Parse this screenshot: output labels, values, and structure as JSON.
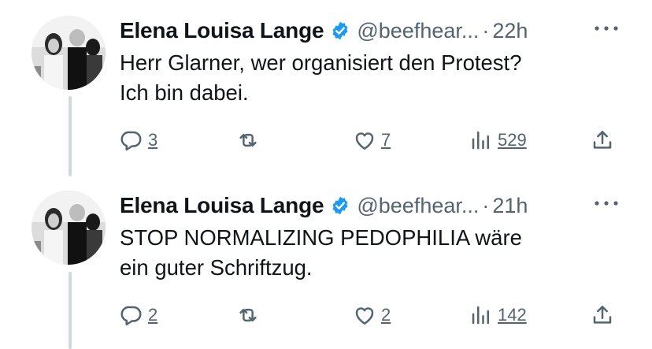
{
  "tweets": [
    {
      "author_name": "Elena Louisa Lange",
      "handle": "@beefhear...",
      "dot": "·",
      "time": "22h",
      "text": "Herr Glarner, wer organisiert den Protest?\nIch bin dabei.",
      "replies": "3",
      "retweets": "",
      "likes": "7",
      "views": "529"
    },
    {
      "author_name": "Elena Louisa Lange",
      "handle": "@beefhear...",
      "dot": "·",
      "time": "21h",
      "text": "STOP NORMALIZING PEDOPHILIA wäre\nein guter Schriftzug.",
      "replies": "2",
      "retweets": "",
      "likes": "2",
      "views": "142"
    }
  ],
  "colors": {
    "verified": "#1d9bf0",
    "secondary_text": "#536471",
    "thread_line": "#cfd9de"
  }
}
